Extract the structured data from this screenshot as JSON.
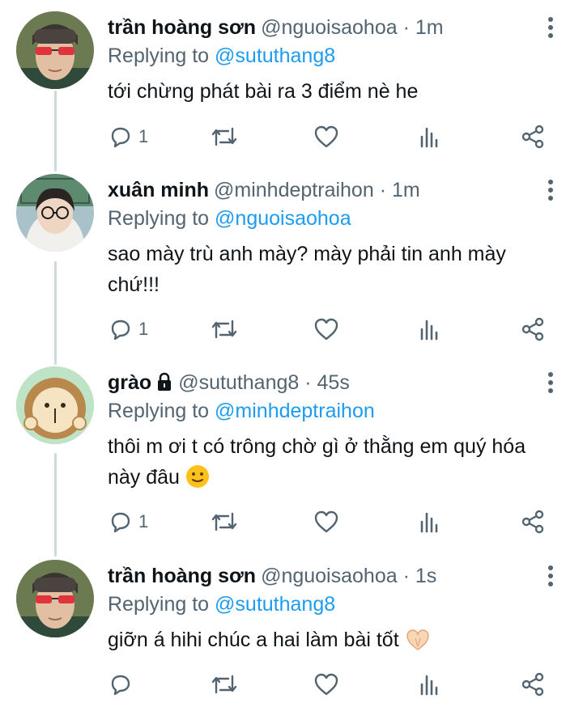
{
  "tweets": [
    {
      "name": "trần hoàng sơn",
      "handle": "@nguoisaohoa",
      "time": "1m",
      "replying_prefix": "Replying to ",
      "replying_to": "@sututhang8",
      "text": "tới chừng phát bài ra 3 điểm nè he",
      "reply_count": "1",
      "locked": false
    },
    {
      "name": "xuân minh",
      "handle": "@minhdeptraihon",
      "time": "1m",
      "replying_prefix": "Replying to ",
      "replying_to": "@nguoisaohoa",
      "text_line1": "sao mày trù anh mày? mày phải tin anh mày",
      "text_line2": "chứ!!!",
      "reply_count": "1",
      "locked": false
    },
    {
      "name": "grào",
      "handle": "@sututhang8",
      "time": "45s",
      "replying_prefix": "Replying to ",
      "replying_to": "@minhdeptraihon",
      "text_line1": "thôi m ơi t có trông chờ gì ở thằng em quý hóa",
      "text_line2": "này đâu",
      "reply_count": "1",
      "locked": true
    },
    {
      "name": "trần hoàng sơn",
      "handle": "@nguoisaohoa",
      "time": "1s",
      "replying_prefix": "Replying to ",
      "replying_to": "@sututhang8",
      "text": "giỡn á hihi chúc a hai làm bài tốt",
      "reply_count": "",
      "locked": false
    }
  ],
  "separator": "·",
  "icons": {
    "reply": "reply-icon",
    "retweet": "retweet-icon",
    "like": "heart-icon",
    "analytics": "analytics-icon",
    "share": "share-icon",
    "more": "more-vertical-icon",
    "lock": "lock-icon"
  },
  "colors": {
    "link": "#1d9bf0",
    "secondary": "#536471",
    "thread_line": "#cfd9de"
  }
}
